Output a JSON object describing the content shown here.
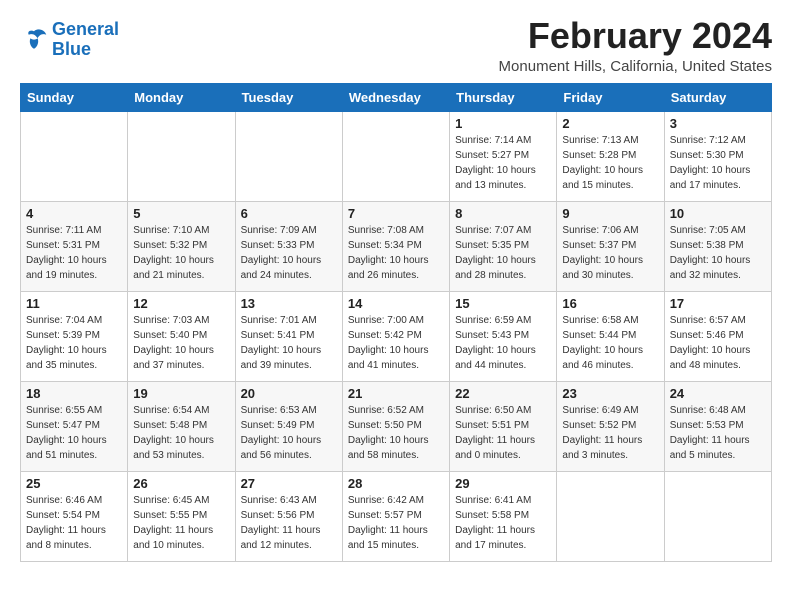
{
  "logo": {
    "line1": "General",
    "line2": "Blue"
  },
  "title": "February 2024",
  "subtitle": "Monument Hills, California, United States",
  "days_of_week": [
    "Sunday",
    "Monday",
    "Tuesday",
    "Wednesday",
    "Thursday",
    "Friday",
    "Saturday"
  ],
  "weeks": [
    [
      {
        "day": "",
        "info": ""
      },
      {
        "day": "",
        "info": ""
      },
      {
        "day": "",
        "info": ""
      },
      {
        "day": "",
        "info": ""
      },
      {
        "day": "1",
        "info": "Sunrise: 7:14 AM\nSunset: 5:27 PM\nDaylight: 10 hours\nand 13 minutes."
      },
      {
        "day": "2",
        "info": "Sunrise: 7:13 AM\nSunset: 5:28 PM\nDaylight: 10 hours\nand 15 minutes."
      },
      {
        "day": "3",
        "info": "Sunrise: 7:12 AM\nSunset: 5:30 PM\nDaylight: 10 hours\nand 17 minutes."
      }
    ],
    [
      {
        "day": "4",
        "info": "Sunrise: 7:11 AM\nSunset: 5:31 PM\nDaylight: 10 hours\nand 19 minutes."
      },
      {
        "day": "5",
        "info": "Sunrise: 7:10 AM\nSunset: 5:32 PM\nDaylight: 10 hours\nand 21 minutes."
      },
      {
        "day": "6",
        "info": "Sunrise: 7:09 AM\nSunset: 5:33 PM\nDaylight: 10 hours\nand 24 minutes."
      },
      {
        "day": "7",
        "info": "Sunrise: 7:08 AM\nSunset: 5:34 PM\nDaylight: 10 hours\nand 26 minutes."
      },
      {
        "day": "8",
        "info": "Sunrise: 7:07 AM\nSunset: 5:35 PM\nDaylight: 10 hours\nand 28 minutes."
      },
      {
        "day": "9",
        "info": "Sunrise: 7:06 AM\nSunset: 5:37 PM\nDaylight: 10 hours\nand 30 minutes."
      },
      {
        "day": "10",
        "info": "Sunrise: 7:05 AM\nSunset: 5:38 PM\nDaylight: 10 hours\nand 32 minutes."
      }
    ],
    [
      {
        "day": "11",
        "info": "Sunrise: 7:04 AM\nSunset: 5:39 PM\nDaylight: 10 hours\nand 35 minutes."
      },
      {
        "day": "12",
        "info": "Sunrise: 7:03 AM\nSunset: 5:40 PM\nDaylight: 10 hours\nand 37 minutes."
      },
      {
        "day": "13",
        "info": "Sunrise: 7:01 AM\nSunset: 5:41 PM\nDaylight: 10 hours\nand 39 minutes."
      },
      {
        "day": "14",
        "info": "Sunrise: 7:00 AM\nSunset: 5:42 PM\nDaylight: 10 hours\nand 41 minutes."
      },
      {
        "day": "15",
        "info": "Sunrise: 6:59 AM\nSunset: 5:43 PM\nDaylight: 10 hours\nand 44 minutes."
      },
      {
        "day": "16",
        "info": "Sunrise: 6:58 AM\nSunset: 5:44 PM\nDaylight: 10 hours\nand 46 minutes."
      },
      {
        "day": "17",
        "info": "Sunrise: 6:57 AM\nSunset: 5:46 PM\nDaylight: 10 hours\nand 48 minutes."
      }
    ],
    [
      {
        "day": "18",
        "info": "Sunrise: 6:55 AM\nSunset: 5:47 PM\nDaylight: 10 hours\nand 51 minutes."
      },
      {
        "day": "19",
        "info": "Sunrise: 6:54 AM\nSunset: 5:48 PM\nDaylight: 10 hours\nand 53 minutes."
      },
      {
        "day": "20",
        "info": "Sunrise: 6:53 AM\nSunset: 5:49 PM\nDaylight: 10 hours\nand 56 minutes."
      },
      {
        "day": "21",
        "info": "Sunrise: 6:52 AM\nSunset: 5:50 PM\nDaylight: 10 hours\nand 58 minutes."
      },
      {
        "day": "22",
        "info": "Sunrise: 6:50 AM\nSunset: 5:51 PM\nDaylight: 11 hours\nand 0 minutes."
      },
      {
        "day": "23",
        "info": "Sunrise: 6:49 AM\nSunset: 5:52 PM\nDaylight: 11 hours\nand 3 minutes."
      },
      {
        "day": "24",
        "info": "Sunrise: 6:48 AM\nSunset: 5:53 PM\nDaylight: 11 hours\nand 5 minutes."
      }
    ],
    [
      {
        "day": "25",
        "info": "Sunrise: 6:46 AM\nSunset: 5:54 PM\nDaylight: 11 hours\nand 8 minutes."
      },
      {
        "day": "26",
        "info": "Sunrise: 6:45 AM\nSunset: 5:55 PM\nDaylight: 11 hours\nand 10 minutes."
      },
      {
        "day": "27",
        "info": "Sunrise: 6:43 AM\nSunset: 5:56 PM\nDaylight: 11 hours\nand 12 minutes."
      },
      {
        "day": "28",
        "info": "Sunrise: 6:42 AM\nSunset: 5:57 PM\nDaylight: 11 hours\nand 15 minutes."
      },
      {
        "day": "29",
        "info": "Sunrise: 6:41 AM\nSunset: 5:58 PM\nDaylight: 11 hours\nand 17 minutes."
      },
      {
        "day": "",
        "info": ""
      },
      {
        "day": "",
        "info": ""
      }
    ]
  ]
}
